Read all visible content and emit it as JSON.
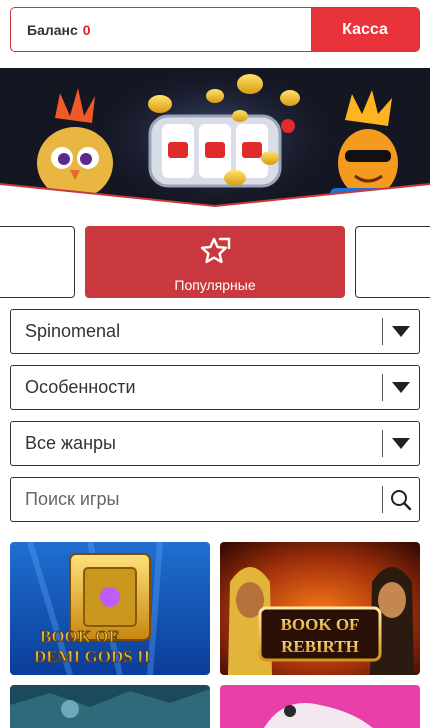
{
  "balance": {
    "label": "Баланс",
    "amount": "0"
  },
  "cashier": {
    "label": "Касса"
  },
  "categories": {
    "active_label": "Популярные"
  },
  "filters": {
    "provider": "Spinomenal",
    "features": "Особенности",
    "genres": "Все жанры"
  },
  "search": {
    "placeholder": "Поиск игры"
  },
  "games": [
    {
      "title_line1": "BOOK OF",
      "title_line2": "DEMI GODS II"
    },
    {
      "title_line1": "BOOK OF",
      "title_line2": "REBIRTH"
    }
  ],
  "colors": {
    "accent": "#e8333a",
    "accent_dark": "#c9383f",
    "balance_value": "#d4262c"
  }
}
